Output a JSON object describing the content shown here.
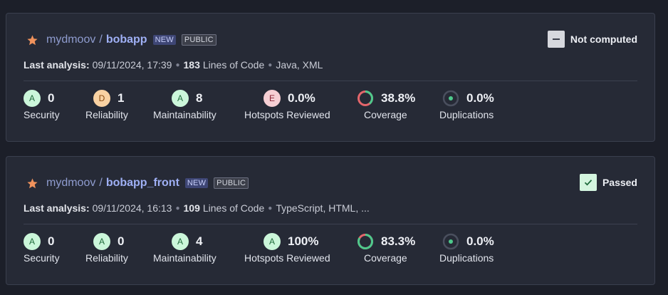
{
  "colors": {
    "background": "#1c1f29",
    "card": "#262a36",
    "rating_A": "#cbf6da",
    "rating_D": "#f9d2a3",
    "rating_E": "#f6cfd4",
    "coverage_good": "#4ec98c",
    "coverage_bad": "#e5666b",
    "star": "#f0925c"
  },
  "projects": [
    {
      "org": "mydmoov",
      "separator": "/",
      "name": "bobapp",
      "badge_new": "NEW",
      "badge_public": "PUBLIC",
      "quality_gate": {
        "label": "Not computed",
        "icon": "minus-icon"
      },
      "meta": {
        "last_analysis_label": "Last analysis:",
        "last_analysis_value": "09/11/2024, 17:39",
        "loc_value": "183",
        "loc_label": "Lines of Code",
        "languages": "Java, XML"
      },
      "metrics": {
        "security": {
          "rating": "A",
          "value": "0",
          "label": "Security"
        },
        "reliability": {
          "rating": "D",
          "value": "1",
          "label": "Reliability"
        },
        "maintainability": {
          "rating": "A",
          "value": "8",
          "label": "Maintainability"
        },
        "hotspots": {
          "rating": "E",
          "value": "0.0%",
          "label": "Hotspots Reviewed"
        },
        "coverage": {
          "value": "38.8%",
          "label": "Coverage",
          "fraction": 0.388
        },
        "duplications": {
          "value": "0.0%",
          "label": "Duplications"
        }
      }
    },
    {
      "org": "mydmoov",
      "separator": "/",
      "name": "bobapp_front",
      "badge_new": "NEW",
      "badge_public": "PUBLIC",
      "quality_gate": {
        "label": "Passed",
        "icon": "check-icon"
      },
      "meta": {
        "last_analysis_label": "Last analysis:",
        "last_analysis_value": "09/11/2024, 16:13",
        "loc_value": "109",
        "loc_label": "Lines of Code",
        "languages": "TypeScript, HTML, ..."
      },
      "metrics": {
        "security": {
          "rating": "A",
          "value": "0",
          "label": "Security"
        },
        "reliability": {
          "rating": "A",
          "value": "0",
          "label": "Reliability"
        },
        "maintainability": {
          "rating": "A",
          "value": "4",
          "label": "Maintainability"
        },
        "hotspots": {
          "rating": "A",
          "value": "100%",
          "label": "Hotspots Reviewed"
        },
        "coverage": {
          "value": "83.3%",
          "label": "Coverage",
          "fraction": 0.833
        },
        "duplications": {
          "value": "0.0%",
          "label": "Duplications"
        }
      }
    }
  ]
}
